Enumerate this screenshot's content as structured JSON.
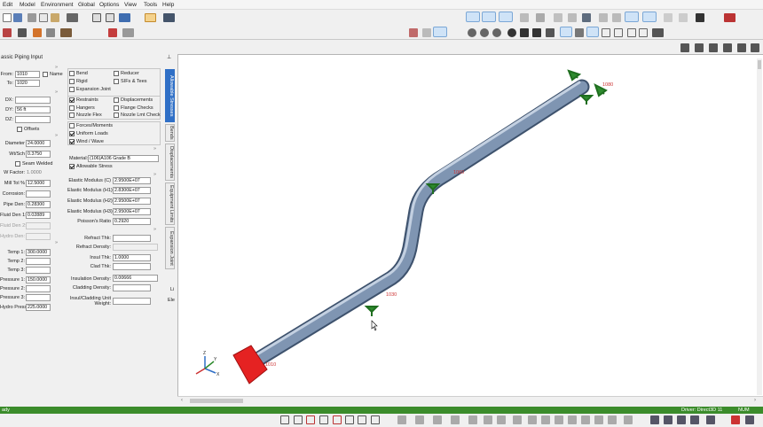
{
  "menu": [
    "Edit",
    "Model",
    "Environment",
    "Global",
    "Options",
    "View",
    "Tools",
    "Help"
  ],
  "panel": {
    "title": "assic Piping Input",
    "from_label": "From:",
    "from": "1010",
    "to_label": "To:",
    "to": "1020",
    "name_label": "Name",
    "dx_label": "DX:",
    "dx": "",
    "dy_label": "DY:",
    "dy": "56 ft",
    "dz_label": "DZ:",
    "dz": "",
    "offsets_label": "Offsets",
    "diameter_label": "Diameter",
    "diameter": "24.0000",
    "wt_label": "Wt/Sch",
    "wt": "0.3750",
    "seam_label": "Seam Welded",
    "wfactor_label": "W Factor:",
    "wfactor": "1.0000",
    "milltol_label": "Mill Tol %",
    "milltol": "12.5000",
    "corrosion_label": "Corrosion:",
    "corrosion": "",
    "pipeden_label": "Pipe Den:",
    "pipeden": "0.28300",
    "fluidden_label": "Fluid Den 1:",
    "fluidden": "0.02889",
    "fluidden2_label": "Fluid Den 2:",
    "hydroden_label": "Hydro Den:",
    "temp1_label": "Temp 1:",
    "temp1": "300.0000",
    "temp2_label": "Temp 2:",
    "temp3_label": "Temp 3:",
    "press1_label": "Pressure 1:",
    "press1": "150.0000",
    "press2_label": "Pressure 2:",
    "press3_label": "Pressure 3:",
    "hydro_label": "Hydro Press:",
    "hydro": "225.0000",
    "checks_left": [
      "Bend",
      "Rigid",
      "Expansion Joint"
    ],
    "checks_right": [
      "Reducer",
      "SIFs & Tees"
    ],
    "checks2_left": [
      "Restraints",
      "Hangers",
      "Nozzle Flex"
    ],
    "checks2_right": [
      "Displacements",
      "Flange Checks",
      "Nozzle Lmt Check"
    ],
    "checks3": [
      "Forces/Moments",
      "Uniform Loads",
      "Wind / Wave"
    ],
    "allowable_label": "Allowable Stress",
    "material_label": "Material:",
    "material": "(106)A106 Grade B",
    "em_c_label": "Elastic Modulus (C)",
    "em_c": "2.9500E+07",
    "em_h1_label": "Elastic Modulus (H1)",
    "em_h1": "2.8300E+07",
    "em_h2_label": "Elastic Modulus (H2)",
    "em_h2": "2.9500E+07",
    "em_h3_label": "Elastic Modulus (H3)",
    "em_h3": "2.9500E+07",
    "poisson_label": "Poisson's Ratio",
    "poisson": "0.2920",
    "refract_label": "Refract Thk:",
    "refract_den_label": "Refract Density:",
    "insul_label": "Insul Thk:",
    "insul": "1.0000",
    "clad_label": "Clad Thk:",
    "insul_den_label": "Insulation Density:",
    "insul_den": "0.00666",
    "cladding_den_label": "Cladding Density:",
    "unit_wt_label": "Insul/Cladding Unit Weight:",
    "vtabs": [
      "Allowable Stresses",
      "Bends",
      "Displacements",
      "Equipment Limits",
      "Expansion Joint"
    ],
    "side_li": "Li",
    "side_ele": "Ele"
  },
  "viewport": {
    "node_labels": [
      "1080",
      "1060",
      "1030",
      "1010"
    ]
  },
  "status": {
    "left": "ady",
    "driver": "Driver: Direct3D 11",
    "units": "NUM"
  },
  "colors": {
    "pipe": "#7f95b2",
    "anchor": "#e52222",
    "restraint": "#2e8b2e",
    "tab_active": "#2f6fc6",
    "status": "#3b8c2b"
  }
}
